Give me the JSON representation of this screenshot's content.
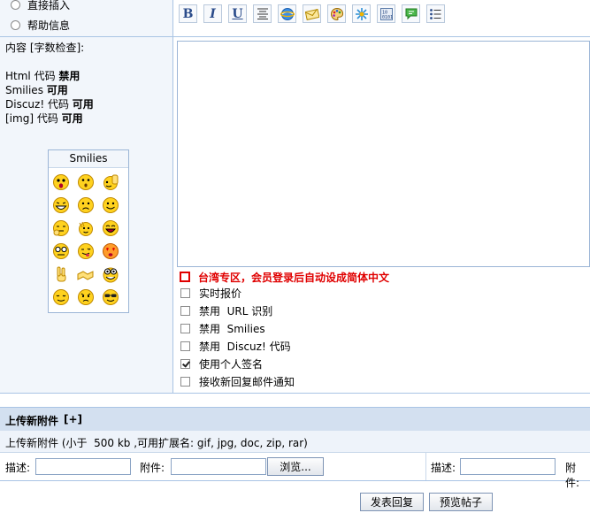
{
  "options": {
    "direct_insert": "直接插入",
    "help_info": "帮助信息"
  },
  "content": {
    "label": "内容 [字数检查]:",
    "html_line": {
      "name": "Html 代码",
      "status": "禁用"
    },
    "smilies_line": {
      "name": "Smilies",
      "status": "可用"
    },
    "discuz_line": {
      "name": "Discuz! 代码",
      "status": "可用"
    },
    "img_line": {
      "name": "[img] 代码",
      "status": "可用"
    }
  },
  "smilies": {
    "title": "Smilies"
  },
  "toolbar": {
    "bold": "B",
    "italic": "I",
    "underline": "U"
  },
  "checkboxes": [
    {
      "label": "台湾专区，会员登录后自动设成简体中文",
      "checked": false,
      "highlight": true
    },
    {
      "label": "实时报价",
      "checked": false
    },
    {
      "label": "禁用  URL 识别",
      "checked": false
    },
    {
      "label": "禁用  Smilies",
      "checked": false
    },
    {
      "label": "禁用  Discuz! 代码",
      "checked": false
    },
    {
      "label": "使用个人签名",
      "checked": true
    },
    {
      "label": "接收新回复邮件通知",
      "checked": false
    }
  ],
  "attachment": {
    "header": "上传新附件",
    "toggle": "[+]",
    "note": "上传新附件 (小于  500 kb ,可用扩展名: gif, jpg, doc, zip, rar)",
    "desc_label": "描述:",
    "file_label": "附件:",
    "browse": "浏览...",
    "desc_label2": "描述:",
    "file_label2": "附件:"
  },
  "actions": {
    "submit": "发表回复",
    "preview": "预览帖子"
  },
  "colors": {
    "panel_bg": "#f2f6fb",
    "border": "#a9c4e4",
    "highlight_red": "#e00000"
  }
}
